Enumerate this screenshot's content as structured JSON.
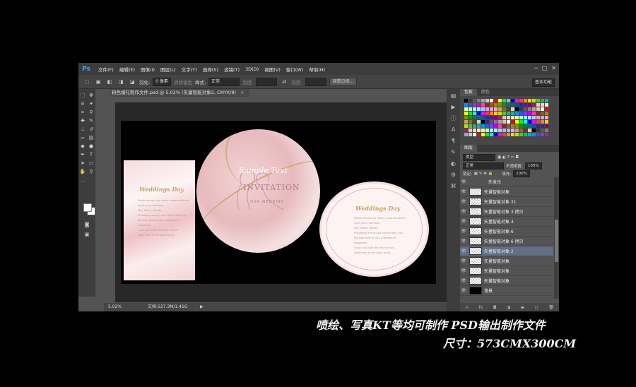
{
  "app": {
    "logo": "Ps"
  },
  "menu": [
    "文件(F)",
    "编辑(E)",
    "图像(I)",
    "图层(L)",
    "文字(Y)",
    "选择(S)",
    "滤镜(T)",
    "3D(D)",
    "视图(V)",
    "窗口(W)",
    "帮助(H)"
  ],
  "window_controls": [
    "─",
    "□",
    "✕"
  ],
  "options_bar": {
    "feather_label": "羽化:",
    "feather_value": "0 像素",
    "antialias_label": "消除锯齿",
    "style_label": "样式:",
    "style_value": "正常",
    "width_label": "宽度:",
    "height_label": "高度:",
    "refine_button": "调整边缘...",
    "workspace": "基本功能"
  },
  "document": {
    "tab_title": "粉色婚礼制作文件.psd @ 5.02% (矢量智能对象2, CMYK/8)",
    "close": "×",
    "zoom": "5.02%",
    "doc_size": "文档:527.3M/1.41G",
    "status_arrow": "▶"
  },
  "artwork": {
    "script_title": "Weddings Day",
    "sample_text": "Sample Text",
    "invitation": "INVITATION",
    "our_wedding": "OUR WEDDING",
    "body_text": "Please accept my lovely congratulations\nupon your marriage.\nMay Peace, Health,\nProsperity and Joy be forever with you.\nWe wish both of you a lifetime of happiness.\nI wish you both the best of luck.\nHappiness to the good party."
  },
  "panels": {
    "tabs_top": [
      "色板",
      "颜色"
    ],
    "tabs_layers": [
      "图层"
    ],
    "filter_label": "类型",
    "blend_mode": "正常",
    "opacity_label": "不透明度:",
    "opacity_value": "100%",
    "lock_label": "锁定:",
    "fill_label": "填充:",
    "fill_value": "100%",
    "layers": [
      {
        "name": "外发光",
        "fx": ""
      },
      {
        "name": "矢量智能对象",
        "fx": ""
      },
      {
        "name": "矢量智能对象 31",
        "fx": ""
      },
      {
        "name": "矢量智能对象 3 拷贝",
        "fx": ""
      },
      {
        "name": "矢量智能对象 4",
        "fx": ""
      },
      {
        "name": "矢量智能对象 6",
        "fx": ""
      },
      {
        "name": "矢量智能对象 6 拷贝",
        "fx": ""
      },
      {
        "name": "矢量智能对象 2",
        "fx": ""
      },
      {
        "name": "矢量智能对象",
        "fx": ""
      },
      {
        "name": "矢量智能对象",
        "fx": ""
      },
      {
        "name": "矢量智能对象",
        "fx": ""
      },
      {
        "name": "背景",
        "fx": ""
      }
    ],
    "footer_icons": [
      "∞",
      "fx",
      "◘",
      "◑",
      "▬",
      "◻",
      "🗑"
    ]
  },
  "swatch_colors": [
    "#000000",
    "#3a3a3a",
    "#595959",
    "#7f7f7f",
    "#a6a6a6",
    "#c8c8c8",
    "#ffffff",
    "#ff0000",
    "#ffff00",
    "#00ff00",
    "#00ffff",
    "#0000ff",
    "#ff00ff",
    "#ff3b3b",
    "#ff8a00",
    "#ffd200",
    "#c0e000",
    "#4fd000",
    "#00c070",
    "#00b4c8",
    "#0090ff",
    "#3050ff",
    "#7a3cff",
    "#c000ff",
    "#ff40a0",
    "#a02020",
    "#a05a00",
    "#a08a00",
    "#6a9a00",
    "#2a8a00",
    "#007a50",
    "#00707a",
    "#005aa0",
    "#1a30a0",
    "#4a2090",
    "#7a0090",
    "#a0205a",
    "#ffc0c0",
    "#ffd8a0",
    "#fff0a0",
    "#e0ffa0",
    "#c0ffc0",
    "#a0ffe0",
    "#a0f0ff",
    "#a0d0ff",
    "#b0b0ff",
    "#d0a0ff",
    "#ffa0e0",
    "#c8a070",
    "#8a6a40",
    "#5a4020",
    "#e8d0b0"
  ],
  "captions": {
    "line1": "喷绘、写真KT等均可制作  PSD输出制作文件",
    "line2": "尺寸：573CMX300CM"
  }
}
